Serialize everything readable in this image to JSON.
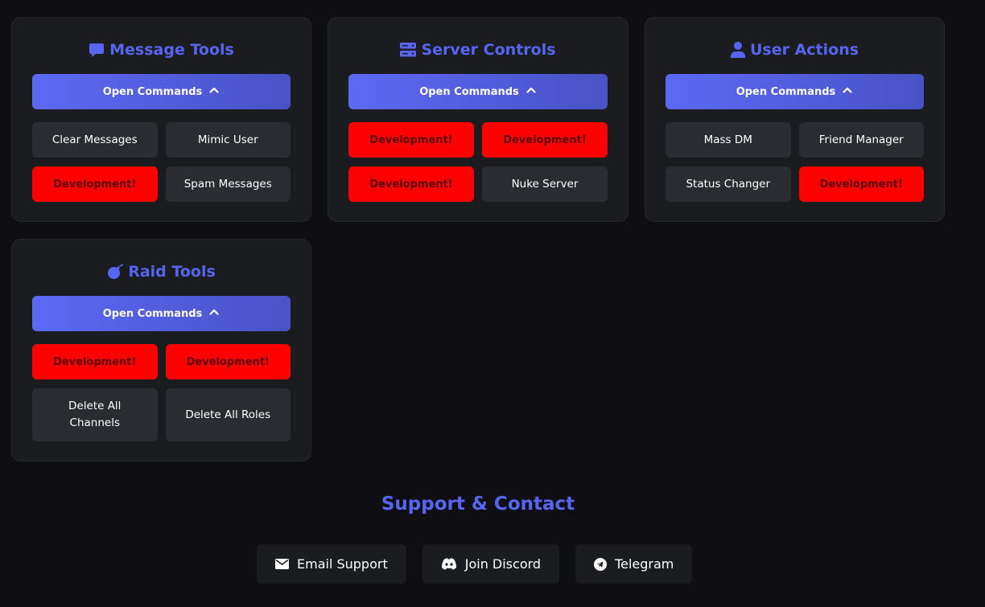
{
  "colors": {
    "accent": "#5865f2",
    "background": "#0f0f13",
    "card": "#1b1c20",
    "command": "#2b2c31",
    "development": "#ff0000"
  },
  "cards": [
    {
      "title": "Message Tools",
      "icon": "message-icon",
      "open_label": "Open Commands",
      "commands": [
        "Clear Messages",
        "Mimic User",
        "Development!",
        "Spam Messages"
      ]
    },
    {
      "title": "Server Controls",
      "icon": "server-icon",
      "open_label": "Open Commands",
      "commands": [
        "Development!",
        "Development!",
        "Development!",
        "Nuke Server"
      ]
    },
    {
      "title": "User Actions",
      "icon": "user-icon",
      "open_label": "Open Commands",
      "commands": [
        "Mass DM",
        "Friend Manager",
        "Status Changer",
        "Development!"
      ]
    },
    {
      "title": "Raid Tools",
      "icon": "bomb-icon",
      "open_label": "Open Commands",
      "commands": [
        "Development!",
        "Development!",
        "Delete All Channels",
        "Delete All Roles"
      ]
    }
  ],
  "support": {
    "title": "Support & Contact",
    "buttons": [
      {
        "label": "Email Support",
        "icon": "envelope-icon"
      },
      {
        "label": "Join Discord",
        "icon": "discord-icon"
      },
      {
        "label": "Telegram",
        "icon": "telegram-icon"
      }
    ]
  }
}
